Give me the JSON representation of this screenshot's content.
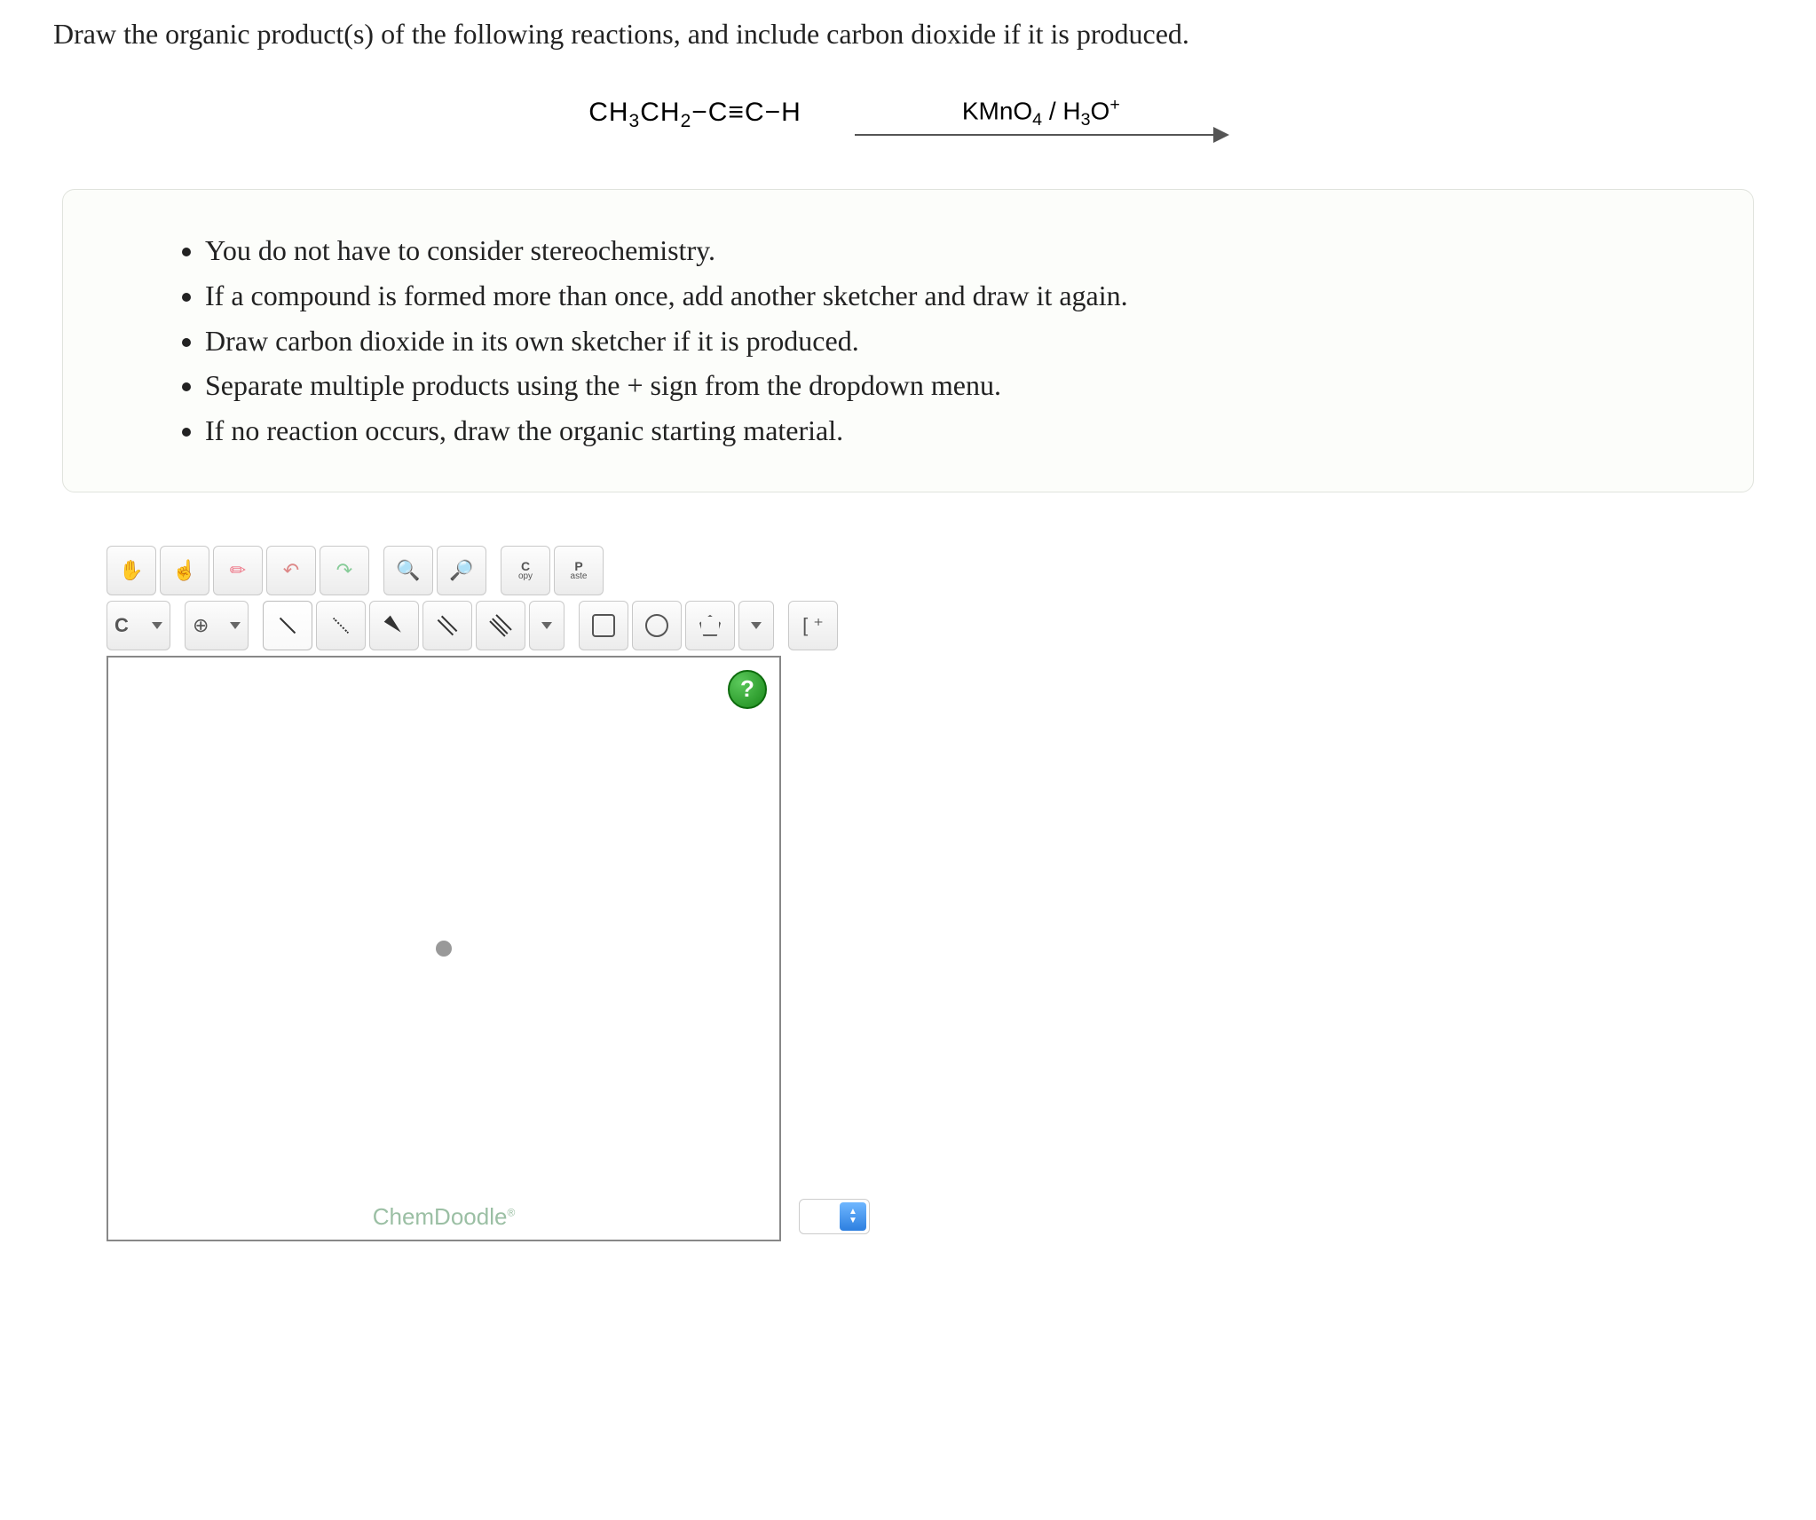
{
  "question": "Draw the organic product(s) of the following reactions, and include carbon dioxide if it is produced.",
  "reaction": {
    "substrate_html": "CH<sub>3</sub>CH<sub>2</sub>−C≡C−H",
    "reagents_html": "KMnO<sub>4</sub> / H<sub>3</sub>O<sup>+</sup>"
  },
  "instructions": [
    "You do not have to consider stereochemistry.",
    "If a compound is formed more than once, add another sketcher and draw it again.",
    "Draw carbon dioxide in its own sketcher if it is produced.",
    "Separate multiple products using the + sign from the dropdown menu.",
    "If no reaction occurs, draw the organic starting material."
  ],
  "toolbar": {
    "row1": {
      "hand": "hand",
      "select": "select",
      "erase": "erase",
      "undo": "undo",
      "redo": "redo",
      "zoom_in": "zoom in",
      "zoom_out": "zoom out",
      "copy_top": "C",
      "copy_bot": "opy",
      "paste_top": "P",
      "paste_bot": "aste"
    },
    "row2": {
      "atom": "C",
      "charge": "⊕",
      "bracket": "[ ⁺"
    }
  },
  "canvas": {
    "help": "?",
    "brand": "ChemDoodle",
    "brand_mark": "®"
  },
  "counter": {
    "value": ""
  }
}
